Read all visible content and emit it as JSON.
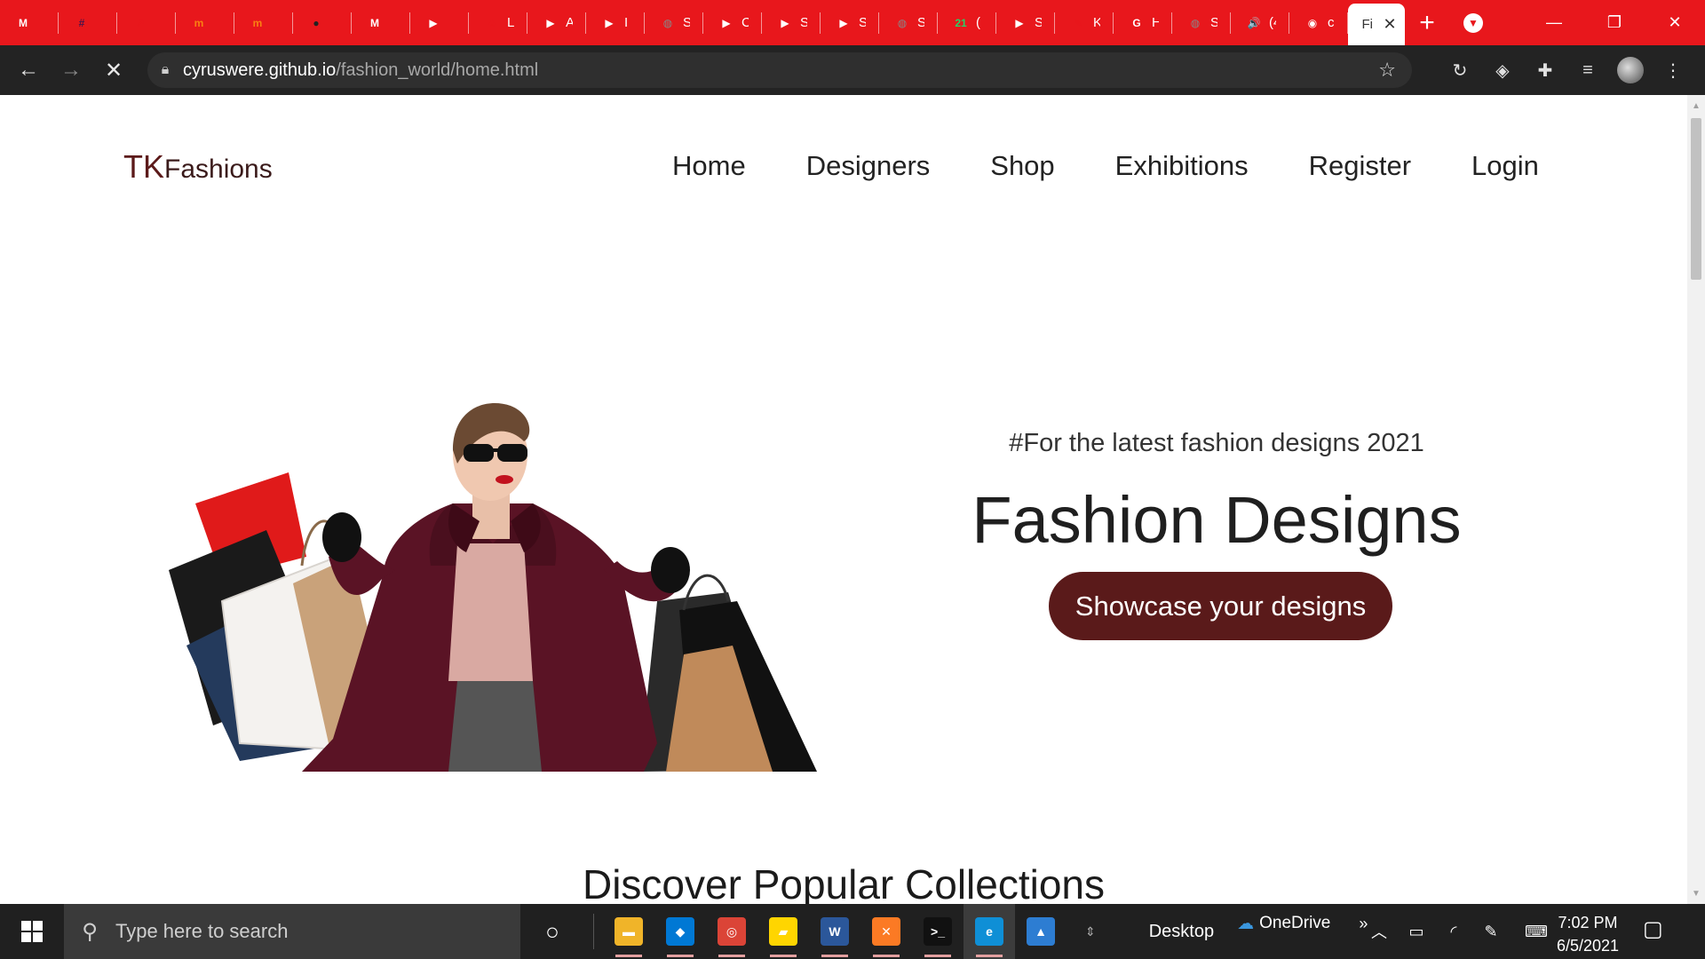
{
  "browser": {
    "tabs": [
      {
        "icon": "gmail-icon",
        "char": "",
        "color": "#ffffff",
        "glyph": "M"
      },
      {
        "icon": "slack-icon",
        "char": "",
        "color": "#4a154b",
        "glyph": "#"
      },
      {
        "icon": "rocket-icon",
        "char": "",
        "color": "#e8171c",
        "glyph": "↗"
      },
      {
        "icon": "moodle-icon",
        "char": "",
        "color": "#f98012",
        "glyph": "m"
      },
      {
        "icon": "moodle-icon",
        "char": "",
        "color": "#f98012",
        "glyph": "m"
      },
      {
        "icon": "colorful-ball-icon",
        "char": "",
        "color": "#222222",
        "glyph": "●"
      },
      {
        "icon": "gmail-icon",
        "char": "",
        "color": "#ffffff",
        "glyph": "M"
      },
      {
        "icon": "youtube-icon",
        "char": "",
        "color": "#ffffff",
        "glyph": "▶"
      },
      {
        "icon": "leaf-icon",
        "char": "L",
        "color": "#e8171c",
        "glyph": "♣"
      },
      {
        "icon": "youtube-icon",
        "char": "A",
        "color": "#ffffff",
        "glyph": "▶"
      },
      {
        "icon": "youtube-icon",
        "char": "I",
        "color": "#ffffff",
        "glyph": "▶"
      },
      {
        "icon": "globe-icon",
        "char": "S",
        "color": "#888888",
        "glyph": "◍"
      },
      {
        "icon": "youtube-icon",
        "char": "C",
        "color": "#ffffff",
        "glyph": "▶"
      },
      {
        "icon": "youtube-icon",
        "char": "S",
        "color": "#ffffff",
        "glyph": "▶"
      },
      {
        "icon": "youtube-icon",
        "char": "S",
        "color": "#ffffff",
        "glyph": "▶"
      },
      {
        "icon": "globe-icon",
        "char": "S",
        "color": "#888888",
        "glyph": "◍"
      },
      {
        "icon": "whatsapp-icon",
        "char": "(",
        "color": "#25d366",
        "glyph": "21"
      },
      {
        "icon": "youtube-icon",
        "char": "S",
        "color": "#ffffff",
        "glyph": "▶"
      },
      {
        "icon": "wand-icon",
        "char": "K",
        "color": "#e8171c",
        "glyph": "✎"
      },
      {
        "icon": "google-icon",
        "char": "H",
        "color": "#ffffff",
        "glyph": "G"
      },
      {
        "icon": "globe-icon",
        "char": "S",
        "color": "#888888",
        "glyph": "◍"
      },
      {
        "icon": "speaker-icon",
        "char": "(4",
        "color": "#e8171c",
        "glyph": "🔊"
      },
      {
        "icon": "github-icon",
        "char": "c",
        "color": "#ffffff",
        "glyph": "◉"
      }
    ],
    "active_tab_char": "Fi",
    "address": {
      "host": "cyruswere.github.io",
      "path": "/fashion_world/home.html"
    }
  },
  "page": {
    "logo_tk": "TK",
    "logo_rest": "Fashions",
    "nav": [
      "Home",
      "Designers",
      "Shop",
      "Exhibitions",
      "Register",
      "Login"
    ],
    "tagline": "#For the latest fashion designs 2021",
    "headline": "Fashion Designs",
    "cta": "Showcase your designs",
    "section_title": "Discover Popular Collections"
  },
  "taskbar": {
    "search_placeholder": "Type here to search",
    "pinned": [
      {
        "name": "file-explorer-icon",
        "color": "#f0b429",
        "glyph": "▬",
        "running": true
      },
      {
        "name": "vscode-icon",
        "color": "#0078d4",
        "glyph": "◆",
        "running": true
      },
      {
        "name": "chrome-icon",
        "color": "#db4437",
        "glyph": "◎",
        "running": true
      },
      {
        "name": "sticky-notes-icon",
        "color": "#ffd500",
        "glyph": "▰",
        "running": true
      },
      {
        "name": "word-icon",
        "color": "#2b579a",
        "glyph": "W",
        "running": true
      },
      {
        "name": "xampp-icon",
        "color": "#fb7a24",
        "glyph": "✕",
        "running": true
      },
      {
        "name": "terminal-icon",
        "color": "#111111",
        "glyph": ">_",
        "running": true
      },
      {
        "name": "edge-icon",
        "color": "#0f8fd6",
        "glyph": "e",
        "running": true,
        "active": true
      },
      {
        "name": "photos-icon",
        "color": "#2d7dd2",
        "glyph": "▲",
        "running": false
      }
    ],
    "desktop_label": "Desktop",
    "onedrive_label": "OneDrive",
    "time": "7:02 PM",
    "date": "6/5/2021"
  },
  "colors": {
    "chrome_red": "#e8171c",
    "brand_maroon": "#5a1a1a"
  }
}
